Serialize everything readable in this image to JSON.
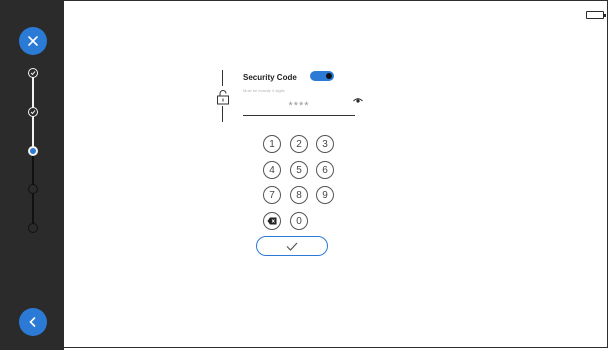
{
  "sidebar": {
    "close_icon": "close-icon",
    "back_icon": "chevron-left-icon",
    "steps": [
      "done",
      "done",
      "active",
      "todo",
      "todo"
    ]
  },
  "security": {
    "label": "Security Code",
    "hint": "Must be exactly 4 digits",
    "masked_value": "****",
    "toggle_on": true
  },
  "keypad": {
    "rows": [
      [
        "1",
        "2",
        "3"
      ],
      [
        "4",
        "5",
        "6"
      ],
      [
        "7",
        "8",
        "9"
      ]
    ],
    "zero": "0"
  },
  "colors": {
    "accent": "#2b7bd6",
    "sidebar": "#2b2b2b"
  }
}
